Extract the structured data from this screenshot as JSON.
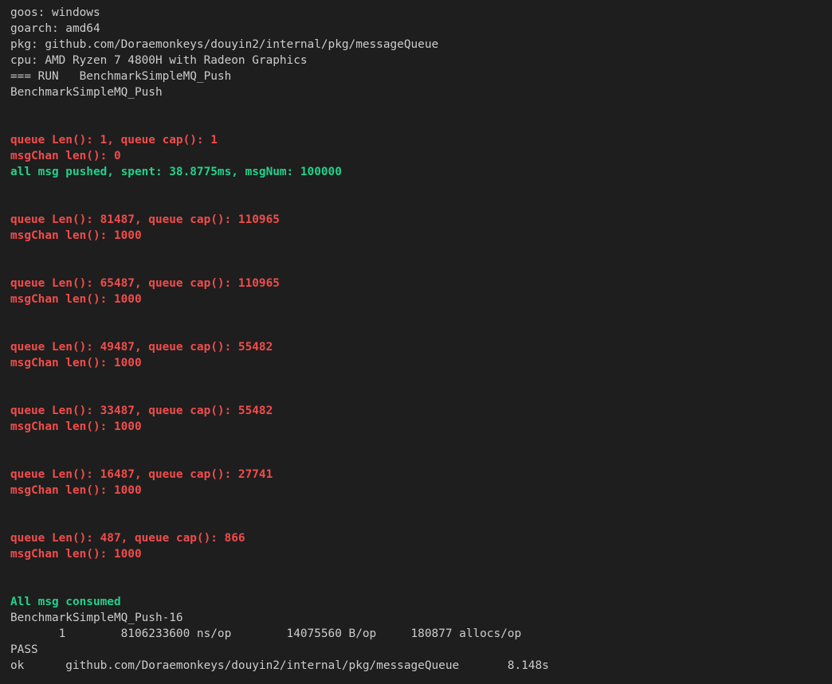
{
  "colors": {
    "background": "#1e1e1e",
    "default_text": "#cccccc",
    "error_red": "#f14c4c",
    "success_green": "#23d18b"
  },
  "terminal": {
    "lines": [
      "goos: windows",
      "goarch: amd64",
      "pkg: github.com/Doraemonkeys/douyin2/internal/pkg/messageQueue",
      "cpu: AMD Ryzen 7 4800H with Radeon Graphics",
      "=== RUN   BenchmarkSimpleMQ_Push",
      "BenchmarkSimpleMQ_Push",
      "",
      "",
      "queue Len(): 1, queue cap(): 1",
      "msgChan len(): 0",
      "all msg pushed, spent: 38.8775ms, msgNum: 100000",
      "",
      "",
      "queue Len(): 81487, queue cap(): 110965",
      "msgChan len(): 1000",
      "",
      "",
      "queue Len(): 65487, queue cap(): 110965",
      "msgChan len(): 1000",
      "",
      "",
      "queue Len(): 49487, queue cap(): 55482",
      "msgChan len(): 1000",
      "",
      "",
      "queue Len(): 33487, queue cap(): 55482",
      "msgChan len(): 1000",
      "",
      "",
      "queue Len(): 16487, queue cap(): 27741",
      "msgChan len(): 1000",
      "",
      "",
      "queue Len(): 487, queue cap(): 866",
      "msgChan len(): 1000",
      "",
      "",
      "All msg consumed",
      "BenchmarkSimpleMQ_Push-16",
      "       1        8106233600 ns/op        14075560 B/op     180877 allocs/op",
      "PASS",
      "ok      github.com/Doraemonkeys/douyin2/internal/pkg/messageQueue       8.148s"
    ]
  }
}
